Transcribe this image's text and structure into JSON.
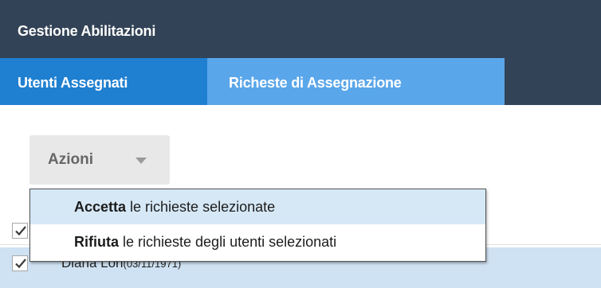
{
  "header": {
    "title": "Gestione Abilitazioni"
  },
  "tabs": [
    {
      "label": "Utenti Assegnati"
    },
    {
      "label": "Richeste di Assegnazione"
    }
  ],
  "actions": {
    "label": "Azioni",
    "menu": [
      {
        "bold": "Accetta",
        "rest": " le richieste selezionate"
      },
      {
        "bold": "Rifiuta",
        "rest": " le richieste degli utenti selezionati"
      }
    ]
  },
  "rows": [
    {
      "name": "Diana Lori",
      "birthdate": "(03/11/1971)"
    }
  ],
  "colors": {
    "header_bg": "#334357",
    "tab_inactive": "#1f7fd0",
    "tab_active": "#5aa6ea",
    "selected_row": "#cfe2f3"
  },
  "icons": {
    "caret": "chevron-down-icon",
    "check": "checkmark-icon"
  }
}
